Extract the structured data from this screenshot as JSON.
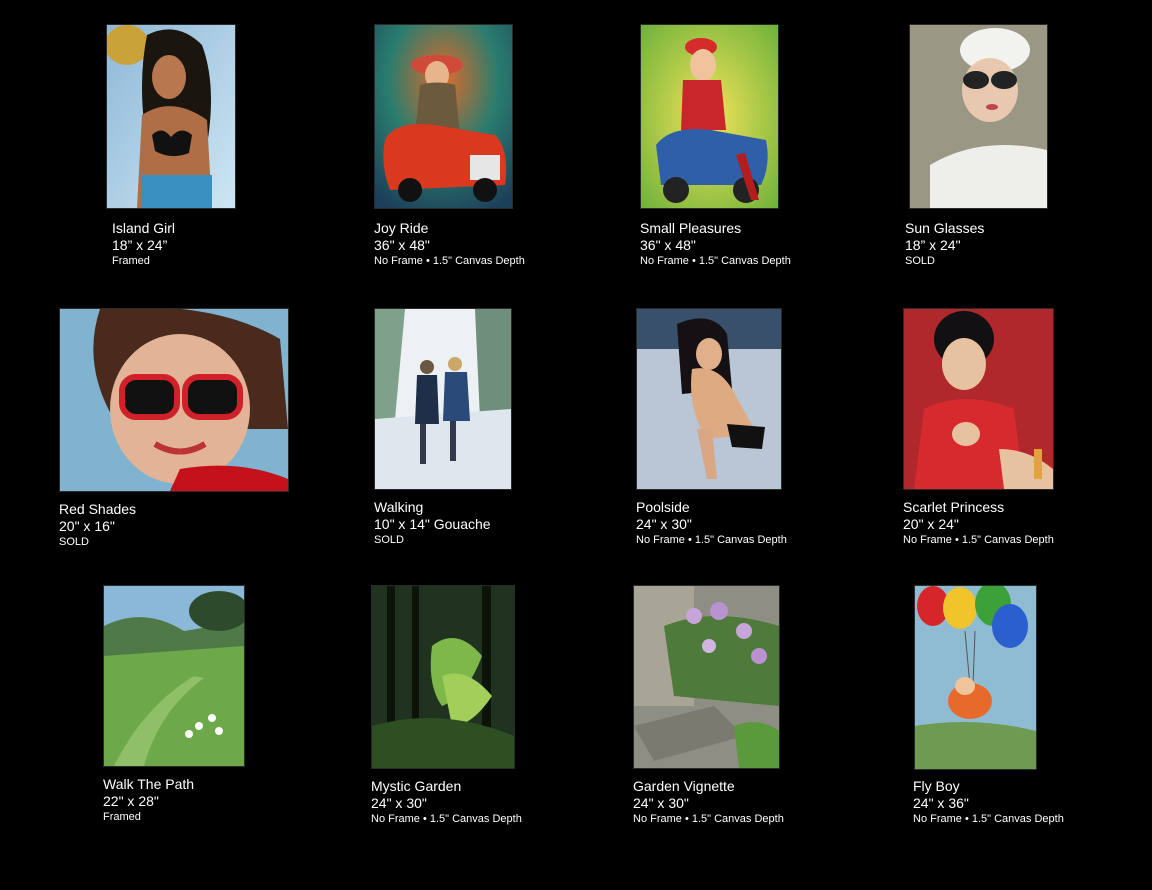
{
  "gallery": {
    "items": [
      {
        "title": "Island Girl",
        "size": "18” x 24”",
        "note": "Framed"
      },
      {
        "title": "Joy Ride",
        "size": "36\" x 48\"",
        "note": "No Frame • 1.5\" Canvas Depth"
      },
      {
        "title": "Small Pleasures",
        "size": "36\" x 48\"",
        "note": "No Frame • 1.5\" Canvas Depth"
      },
      {
        "title": "Sun Glasses",
        "size": "18” x 24\"",
        "note": "SOLD"
      },
      {
        "title": "Red Shades",
        "size": "20\" x 16\"",
        "note": "SOLD"
      },
      {
        "title": "Walking",
        "size": "10\" x 14\" Gouache",
        "note": "SOLD"
      },
      {
        "title": "Poolside",
        "size": "24\" x 30\"",
        "note": "No Frame • 1.5\" Canvas Depth"
      },
      {
        "title": "Scarlet Princess",
        "size": "20\" x 24\"",
        "note": "No Frame • 1.5\" Canvas Depth"
      },
      {
        "title": "Walk The Path",
        "size": "22\" x 28\"",
        "note": "Framed"
      },
      {
        "title": "Mystic Garden",
        "size": "24\" x 30\"",
        "note": "No Frame • 1.5\" Canvas Depth"
      },
      {
        "title": "Garden Vignette",
        "size": "24\" x 30\"",
        "note": "No Frame • 1.5\" Canvas Depth"
      },
      {
        "title": "Fly Boy",
        "size": "24\" x 36\"",
        "note": "No Frame • 1.5\" Canvas Depth"
      }
    ]
  }
}
